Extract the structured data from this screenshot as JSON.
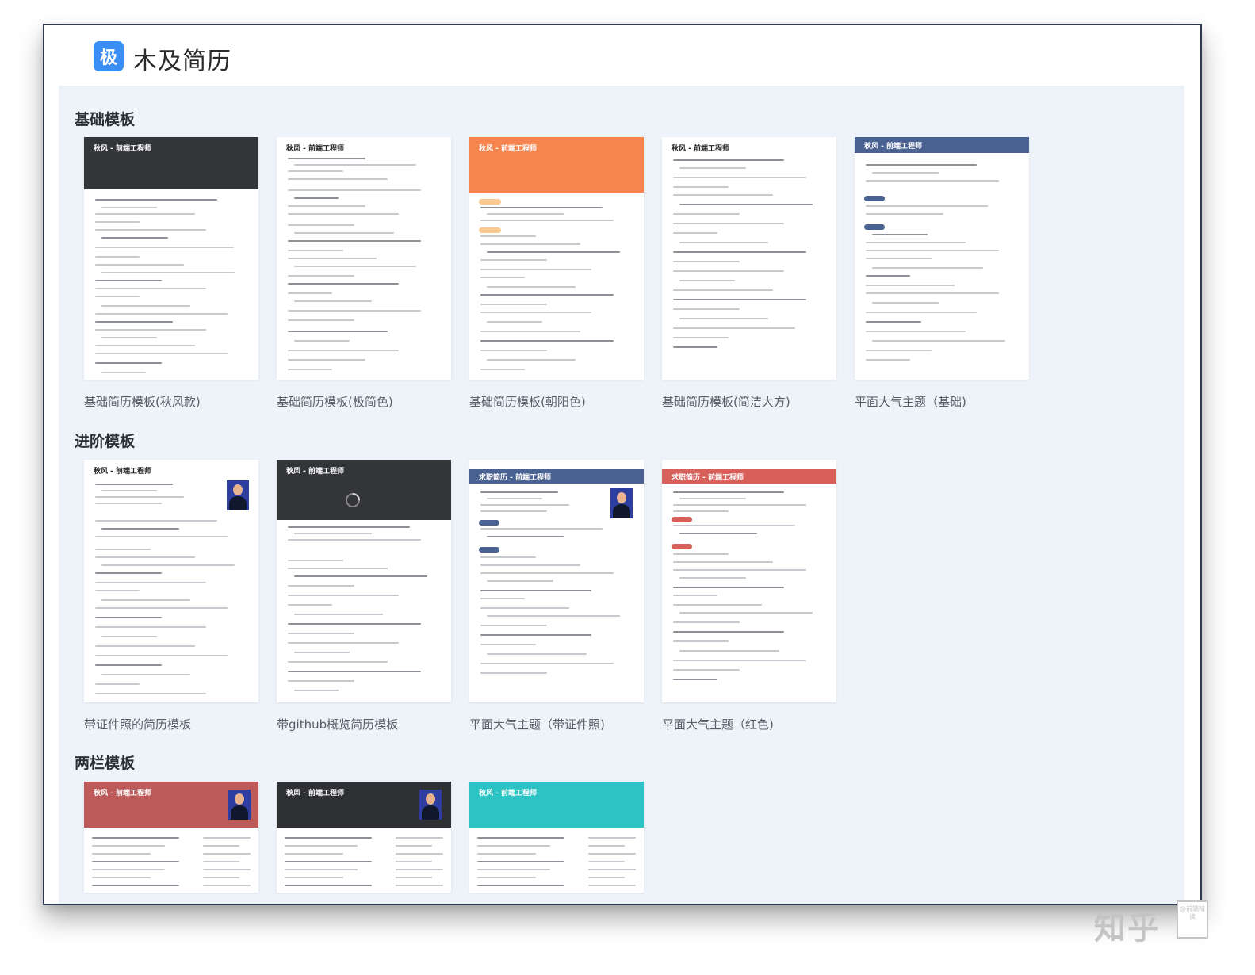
{
  "app": {
    "logo_char": "极",
    "title": "木及简历"
  },
  "sections": {
    "basic": {
      "title": "基础模板",
      "cards": [
        {
          "label": "基础简历模板(秋风款)",
          "preview_name": "秋风 - 前端工程师",
          "header_color": "#333539"
        },
        {
          "label": "基础简历模板(极简色)",
          "preview_name": "秋风 - 前端工程师",
          "header_color": "#ffffff"
        },
        {
          "label": "基础简历模板(朝阳色)",
          "preview_name": "秋风 - 前端工程师",
          "header_color": "#f7844c"
        },
        {
          "label": "基础简历模板(简洁大方)",
          "preview_name": "秋风 - 前端工程师",
          "header_color": "#ffffff"
        },
        {
          "label": "平面大气主题（基础)",
          "preview_name": "秋风 - 前端工程师",
          "header_color": "#4a6291"
        }
      ]
    },
    "advanced": {
      "title": "进阶模板",
      "cards": [
        {
          "label": "带证件照的简历模板",
          "preview_name": "秋风 - 前端工程师",
          "header_color": "#ffffff"
        },
        {
          "label": "带github概览简历模板",
          "preview_name": "秋风 - 前端工程师",
          "header_color": "#333539"
        },
        {
          "label": "平面大气主题（带证件照)",
          "preview_name": "求职简历 - 前端工程师",
          "header_color": "#4a6291"
        },
        {
          "label": "平面大气主题（红色)",
          "preview_name": "求职简历 - 前端工程师",
          "header_color": "#d9605a"
        }
      ]
    },
    "two_column": {
      "title": "两栏模板",
      "cards": [
        {
          "preview_name": "秋风 - 前端工程师",
          "header_color": "#bd5a5a"
        },
        {
          "preview_name": "秋风 - 前端工程师",
          "header_color": "#2f3033"
        },
        {
          "preview_name": "秋风 - 前端工程师",
          "header_color": "#2cc3c4"
        }
      ]
    }
  },
  "watermark": {
    "text": "知乎",
    "stamp": "@前端精读"
  }
}
